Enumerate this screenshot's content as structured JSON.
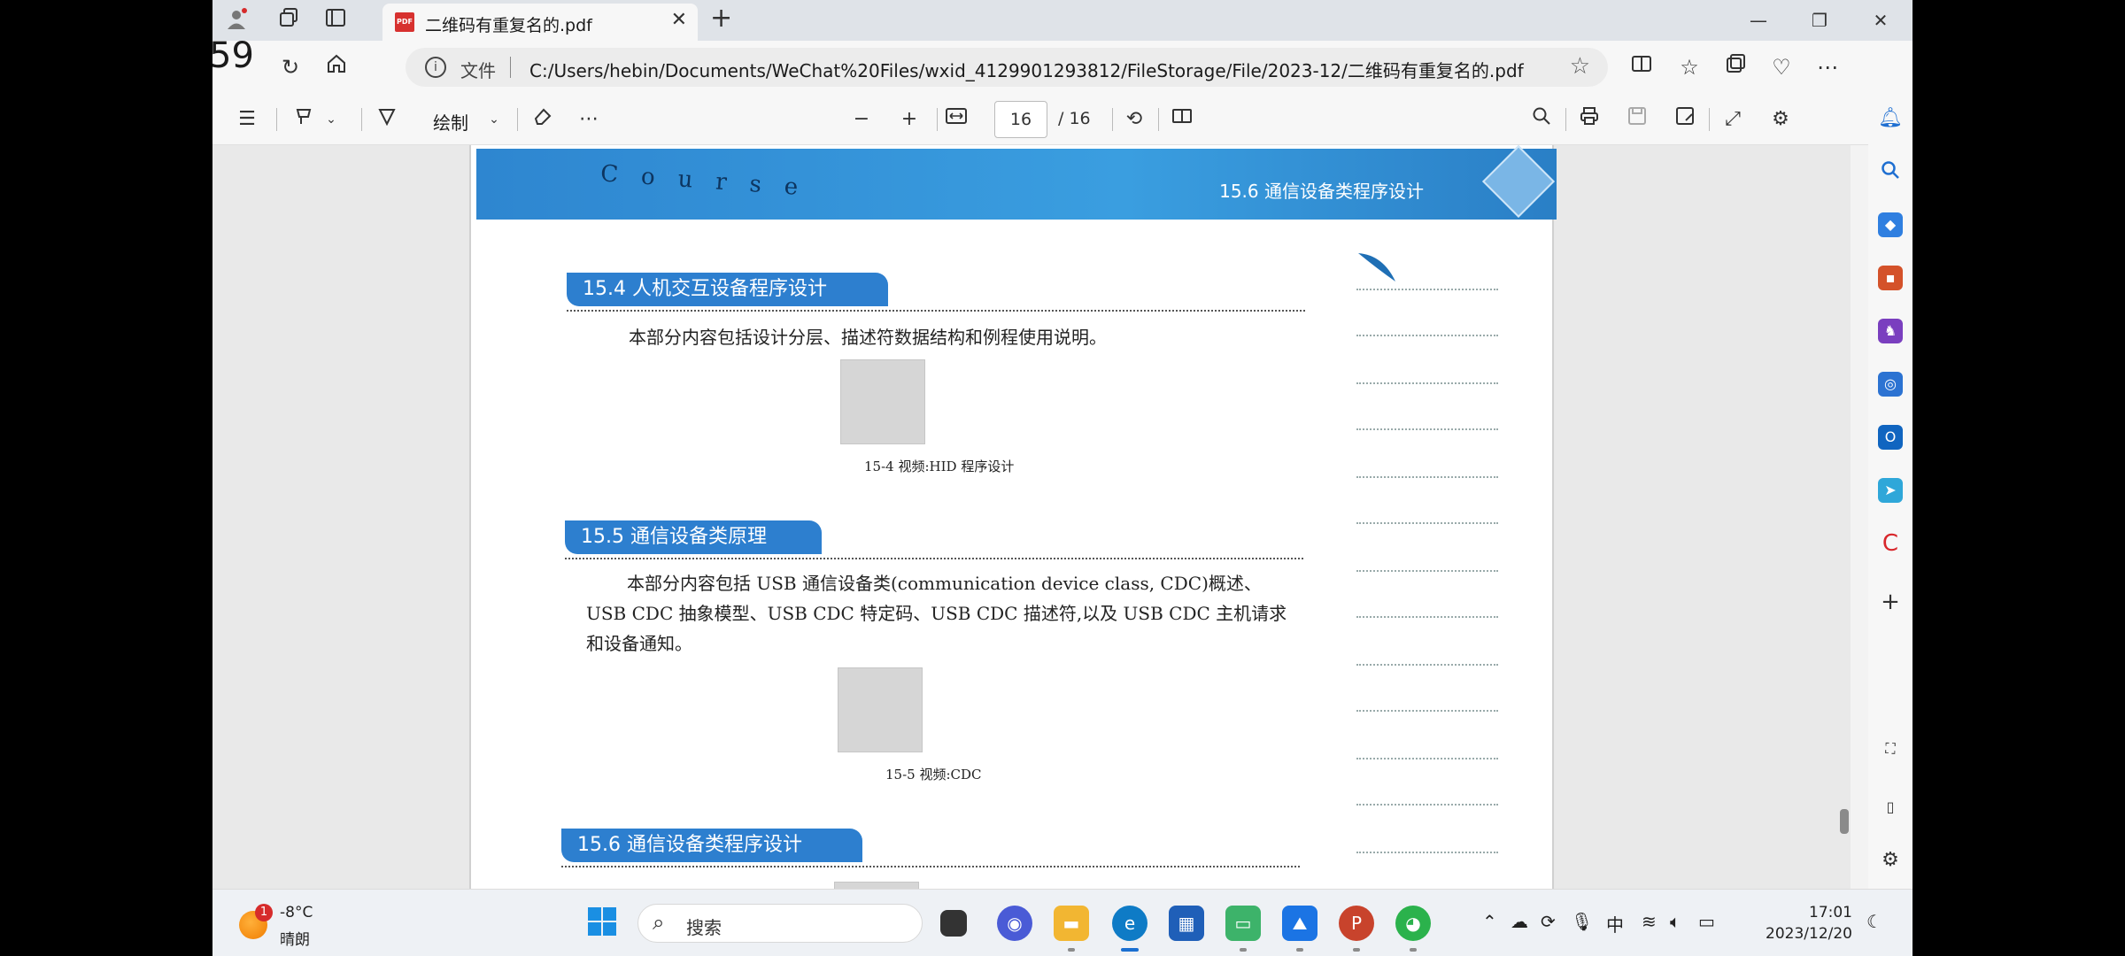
{
  "browser": {
    "tab_title": "二维码有重复名的.pdf",
    "tab_icon_label": "PDF",
    "overlay_number": "59",
    "address": {
      "file_label": "文件",
      "url": "C:/Users/hebin/Documents/WeChat%20Files/wxid_4129901293812/FileStorage/File/2023-12/二维码有重复名的.pdf"
    }
  },
  "pdf_toolbar": {
    "draw_label": "绘制",
    "page_current": "16",
    "page_total": "/ 16"
  },
  "document": {
    "header_letters": "Course",
    "header_title": "15.6   通信设备类程序设计",
    "sections": [
      {
        "title": "15.4   人机交互设备程序设计",
        "body": "本部分内容包括设计分层、描述符数据结构和例程使用说明。",
        "caption": "15-4 视频:HID 程序设计"
      },
      {
        "title": "15.5   通信设备类原理",
        "body_lines": [
          "本部分内容包括 USB 通信设备类(communication device class, CDC)概述、",
          "USB CDC 抽象模型、USB CDC 特定码、USB CDC 描述符,以及 USB CDC 主机请求",
          "和设备通知。"
        ],
        "caption": "15-5 视频:CDC"
      },
      {
        "title": "15.6   通信设备类程序设计"
      }
    ]
  },
  "taskbar": {
    "weather_badge": "1",
    "weather_temp": "-8°C",
    "weather_desc": "晴朗",
    "search_placeholder": "搜索",
    "ime": "中",
    "time": "17:01",
    "date": "2023/12/20"
  },
  "colors": {
    "accent_blue": "#2d7fcf",
    "pdf_red": "#d7312f"
  }
}
